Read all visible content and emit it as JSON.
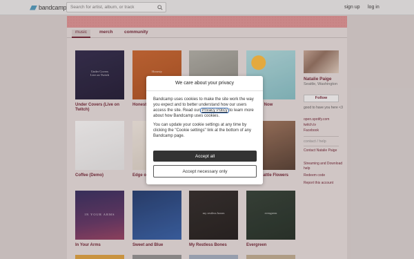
{
  "header": {
    "logo_text": "bandcamp",
    "search_placeholder": "Search for artist, album, or track",
    "signup": "sign up",
    "login": "log in"
  },
  "tabs": [
    "music",
    "merch",
    "community"
  ],
  "albums": [
    {
      "title": "Under Covers (Live on Twitch)",
      "art_text": "Under Covers\nLive on Twitch"
    },
    {
      "title": "Honest",
      "art_text": "Honesty"
    },
    {
      "title": "",
      "art_text": ""
    },
    {
      "title": "py Now",
      "art_text": ""
    },
    {
      "title": "Coffee (Demo)",
      "art_text": ""
    },
    {
      "title": "Edge of (Demo)",
      "art_text": ""
    },
    {
      "title": "Seattle Flowers",
      "art_text": ""
    },
    {
      "title": "In Your Arms",
      "art_text": "IN YOUR ARMS"
    },
    {
      "title": "Sweet and Blue",
      "art_text": ""
    },
    {
      "title": "My Restless Bones",
      "art_text": "my restless bones"
    },
    {
      "title": "Evergreen",
      "art_text": "evergreen"
    }
  ],
  "sidebar": {
    "name": "Natalie Paige",
    "location": "Seattle, Washington",
    "follow": "Follow",
    "bio": "good to have you here <3",
    "links": [
      "open.spotify.com",
      "twitch.tv",
      "Facebook"
    ],
    "contact_heading": "contact / help",
    "contact_links": [
      "Contact Natalie Paige",
      "Streaming and Download help",
      "Redeem code",
      "Report this account"
    ]
  },
  "modal": {
    "title": "We care about your privacy",
    "body1_pre": "Bandcamp uses cookies to make the site work the way you expect and to better understand how our users access the site. Read our ",
    "policy_link": "Privacy Policy",
    "body1_post": " to learn more about how Bandcamp uses cookies.",
    "body2": "You can update your cookie settings at any time by clicking the \"Cookie settings\" link at the bottom of any Bandcamp page.",
    "accept_all": "Accept all",
    "accept_necessary": "Accept necessary only"
  },
  "colors": {
    "accent": "#6a2030",
    "banner": "#d58c8e",
    "logo": "#4a93b4"
  }
}
